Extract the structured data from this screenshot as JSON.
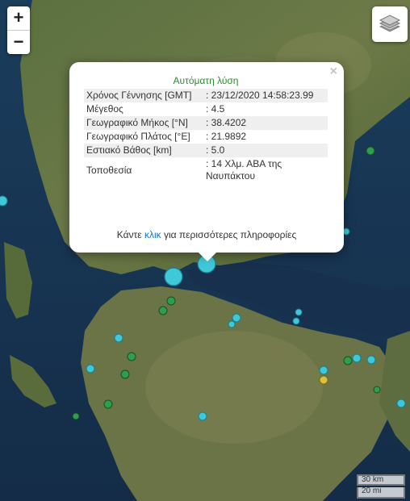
{
  "popup": {
    "title": "Αυτόματη λύση",
    "rows": [
      {
        "label": "Χρόνος Γέννησης [GMT]",
        "value": ": 23/12/2020 14:58:23.99"
      },
      {
        "label": "Μέγεθος",
        "value": ": 4.5"
      },
      {
        "label": "Γεωγραφικό Μήκος [°N]",
        "value": ": 38.4202"
      },
      {
        "label": "Γεωγραφικό Πλάτος [°E]",
        "value": ": 21.9892"
      },
      {
        "label": "Εστιακό Βάθος [km]",
        "value": ": 5.0"
      },
      {
        "label": "Τοποθεσία",
        "value": ": 14 Χλμ. ΑΒΑ της Ναυπάκτου"
      }
    ],
    "more_before": "Κάντε ",
    "more_link": "κλικ",
    "more_after": " για περισσότερες πληροφορίες",
    "close": "×"
  },
  "zoom": {
    "in": "+",
    "out": "−"
  },
  "layers_icon": "layers-icon",
  "scale": {
    "metric": "30 km",
    "imperial": "20 mi"
  },
  "colors": {
    "marker_cyan": "#3fc8d8",
    "marker_green": "#2e9e4e",
    "marker_yellow": "#d8c23a",
    "sea": "#17324f",
    "land": "#556b35"
  }
}
